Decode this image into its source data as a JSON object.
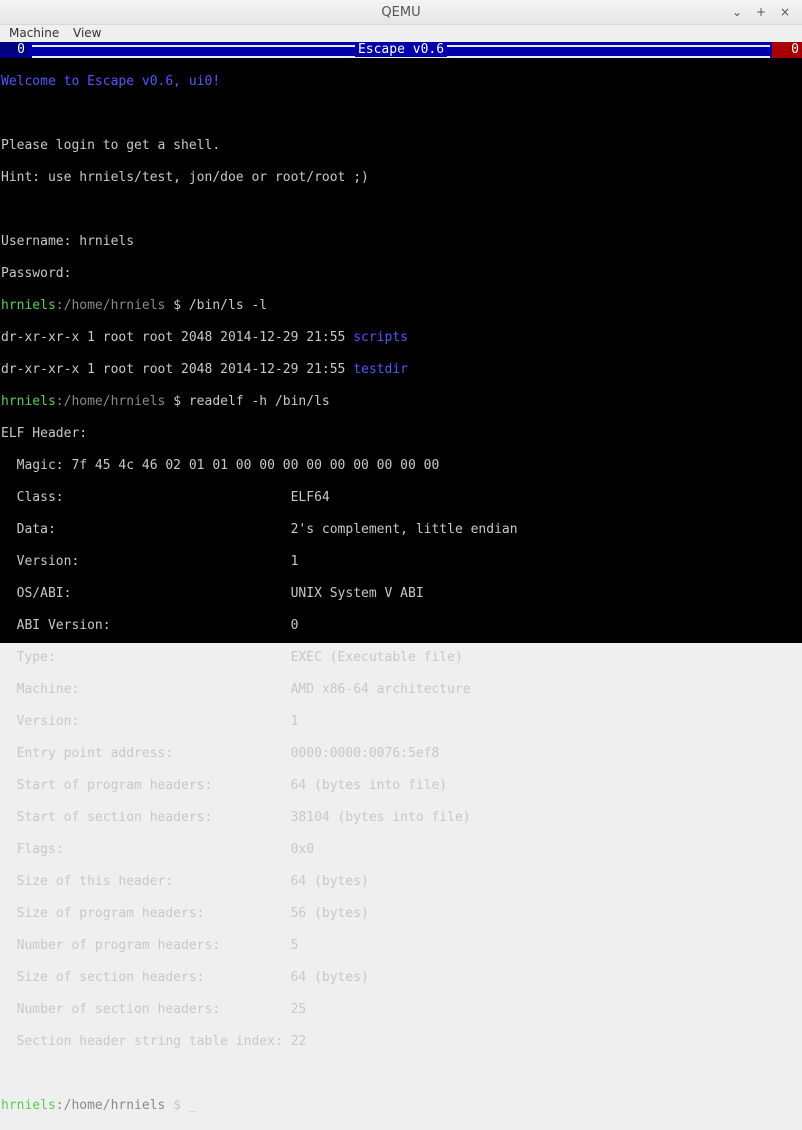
{
  "window": {
    "title": "QEMU",
    "buttons": [
      "⌄",
      "+",
      "×"
    ]
  },
  "menu": {
    "items": [
      "Machine",
      "View"
    ]
  },
  "topbar": {
    "left": "0",
    "title": "Escape v0.6",
    "right": "0"
  },
  "terminal": {
    "welcome": "Welcome to Escape v0.6, ui0!",
    "login_msg": "Please login to get a shell.",
    "hint": "Hint: use hrniels/test, jon/doe or root/root ;)",
    "username_line": "Username: hrniels",
    "password_line": "Password:",
    "prompt_user": "hrniels",
    "prompt_path": ":/home/hrniels",
    "prompt_sym": " $ ",
    "cmd1": "/bin/ls -l",
    "ls": [
      {
        "meta": "dr-xr-xr-x 1 root root 2048 2014-12-29 21:55 ",
        "name": "scripts"
      },
      {
        "meta": "dr-xr-xr-x 1 root root 2048 2014-12-29 21:55 ",
        "name": "testdir"
      }
    ],
    "cmd2": "readelf -h /bin/ls",
    "elf_header": "ELF Header:",
    "magic": "  Magic: 7f 45 4c 46 02 01 01 00 00 00 00 00 00 00 00 00",
    "fields": [
      "  Class:                             ELF64",
      "  Data:                              2's complement, little endian",
      "  Version:                           1",
      "  OS/ABI:                            UNIX System V ABI",
      "  ABI Version:                       0",
      "  Type:                              EXEC (Executable file)",
      "  Machine:                           AMD x86-64 architecture",
      "  Version:                           1",
      "  Entry point address:               0000:0000:0076:5ef8",
      "  Start of program headers:          64 (bytes into file)",
      "  Start of section headers:          38104 (bytes into file)",
      "  Flags:                             0x0",
      "  Size of this header:               64 (bytes)",
      "  Size of program headers:           56 (bytes)",
      "  Number of program headers:         5",
      "  Size of section headers:           64 (bytes)",
      "  Number of section headers:         25",
      "  Section header string table index: 22"
    ],
    "cursor": "_"
  }
}
